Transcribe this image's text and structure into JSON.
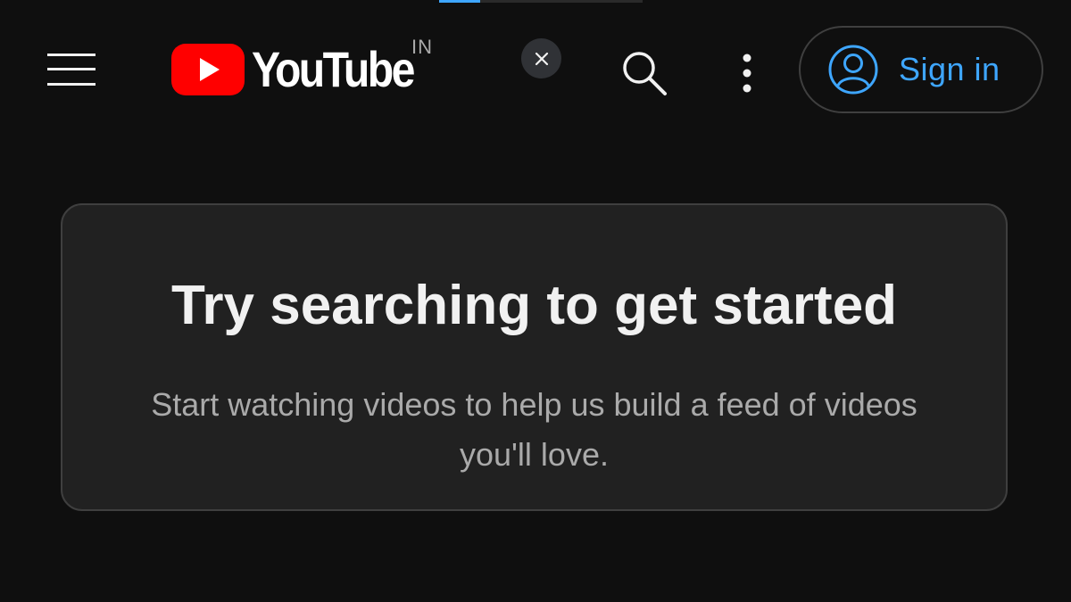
{
  "header": {
    "logo_text": "YouTube",
    "region_code": "IN",
    "menu_icon": "hamburger-menu-icon",
    "search_icon": "search-icon",
    "more_icon": "vertical-dots-icon",
    "dismiss_icon": "close-icon",
    "account_icon": "account-circle-icon",
    "sign_in_label": "Sign in"
  },
  "loading": {
    "progress_fraction": 0.2
  },
  "empty_state": {
    "title": "Try searching to get started",
    "message": "Start watching videos to help us build a feed of videos you'll love."
  },
  "colors": {
    "background": "#0f0f0f",
    "card": "#212121",
    "brand_red": "#ff0000",
    "accent_blue": "#3ea6ff",
    "secondary_text": "#aaaaaa"
  }
}
